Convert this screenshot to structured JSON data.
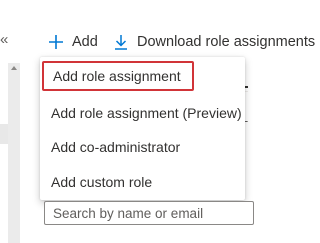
{
  "nav": {
    "collapse_glyph": "«"
  },
  "toolbar": {
    "add_label": "Add",
    "add_icon": "plus-icon",
    "download_label": "Download role assignments",
    "download_icon": "download-icon",
    "accent_color": "#0078d4"
  },
  "background": {
    "tab_fragment": "n",
    "filter_fragment": "T"
  },
  "menu": {
    "items": [
      {
        "label": "Add role assignment",
        "highlighted": true
      },
      {
        "label": "Add role assignment (Preview)"
      },
      {
        "label": "Add co-administrator"
      },
      {
        "label": "Add custom role"
      }
    ],
    "highlight_color": "#d13438"
  },
  "search": {
    "placeholder": "Search by name or email",
    "value": ""
  }
}
